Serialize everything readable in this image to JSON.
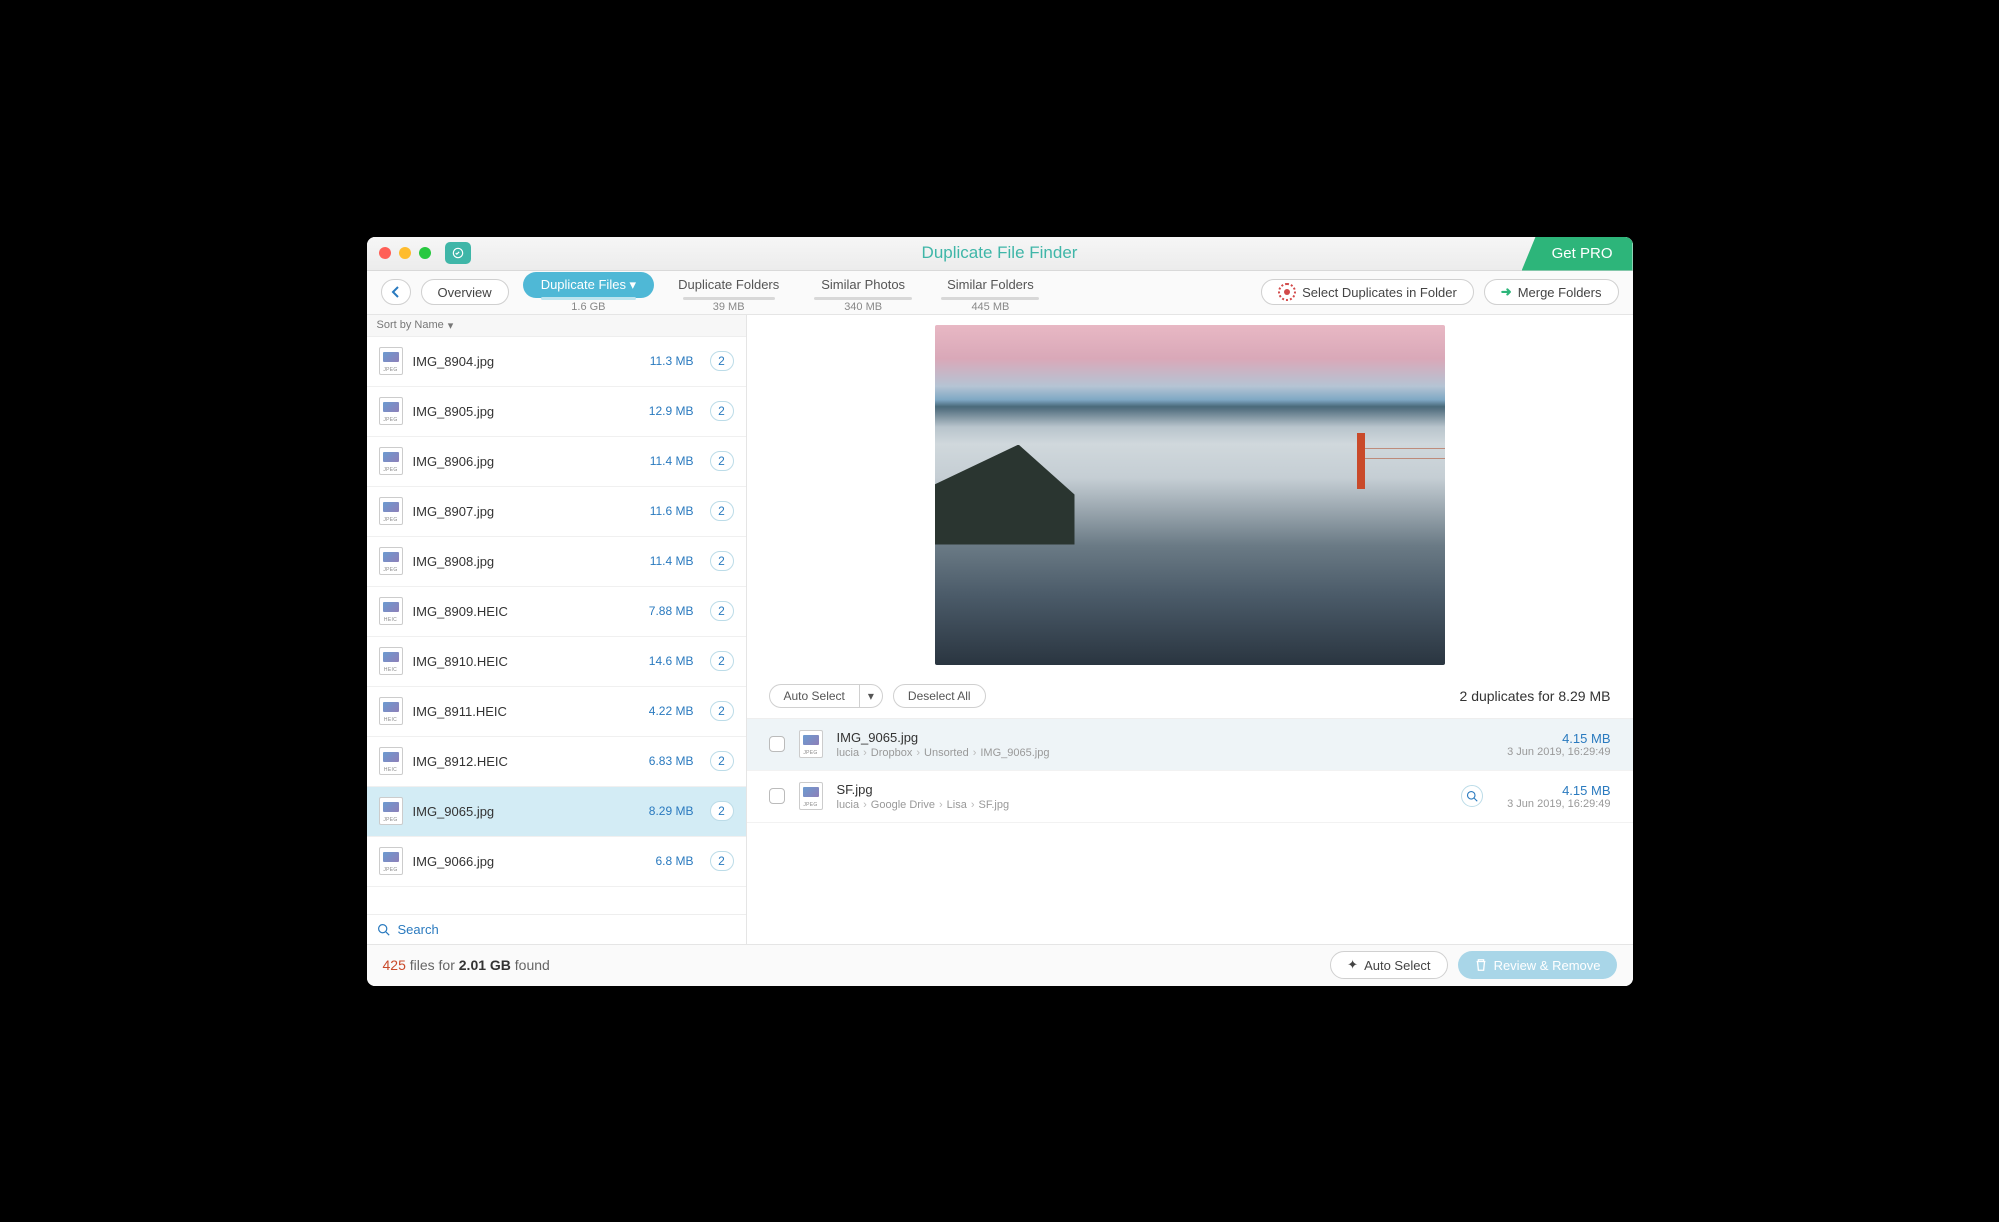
{
  "title": "Duplicate File Finder",
  "get_pro": "Get PRO",
  "toolbar": {
    "overview": "Overview",
    "select_in_folder": "Select Duplicates in Folder",
    "merge_folders": "Merge Folders"
  },
  "tabs": [
    {
      "label": "Duplicate Files",
      "size": "1.6 GB",
      "active": true,
      "dropdown": true
    },
    {
      "label": "Duplicate Folders",
      "size": "39 MB",
      "active": false
    },
    {
      "label": "Similar Photos",
      "size": "340 MB",
      "active": false
    },
    {
      "label": "Similar Folders",
      "size": "445 MB",
      "active": false
    }
  ],
  "sort_label": "Sort by Name",
  "files": [
    {
      "name": "IMG_8904.jpg",
      "size": "11.3 MB",
      "count": "2",
      "ext": "JPEG"
    },
    {
      "name": "IMG_8905.jpg",
      "size": "12.9 MB",
      "count": "2",
      "ext": "JPEG"
    },
    {
      "name": "IMG_8906.jpg",
      "size": "11.4 MB",
      "count": "2",
      "ext": "JPEG"
    },
    {
      "name": "IMG_8907.jpg",
      "size": "11.6 MB",
      "count": "2",
      "ext": "JPEG"
    },
    {
      "name": "IMG_8908.jpg",
      "size": "11.4 MB",
      "count": "2",
      "ext": "JPEG"
    },
    {
      "name": "IMG_8909.HEIC",
      "size": "7.88 MB",
      "count": "2",
      "ext": "HEIC"
    },
    {
      "name": "IMG_8910.HEIC",
      "size": "14.6 MB",
      "count": "2",
      "ext": "HEIC"
    },
    {
      "name": "IMG_8911.HEIC",
      "size": "4.22 MB",
      "count": "2",
      "ext": "HEIC"
    },
    {
      "name": "IMG_8912.HEIC",
      "size": "6.83 MB",
      "count": "2",
      "ext": "HEIC"
    },
    {
      "name": "IMG_9065.jpg",
      "size": "8.29 MB",
      "count": "2",
      "ext": "JPEG",
      "selected": true
    },
    {
      "name": "IMG_9066.jpg",
      "size": "6.8 MB",
      "count": "2",
      "ext": "JPEG"
    }
  ],
  "search_placeholder": "Search",
  "detail": {
    "auto_select": "Auto Select",
    "deselect_all": "Deselect All",
    "summary": "2 duplicates for 8.29 MB"
  },
  "dupes": [
    {
      "name": "IMG_9065.jpg",
      "path": [
        "lucia",
        "Dropbox",
        "Unsorted",
        "IMG_9065.jpg"
      ],
      "size": "4.15 MB",
      "date": "3 Jun 2019, 16:29:49",
      "selected": true
    },
    {
      "name": "SF.jpg",
      "path": [
        "lucia",
        "Google Drive",
        "Lisa",
        "SF.jpg"
      ],
      "size": "4.15 MB",
      "date": "3 Jun 2019, 16:29:49",
      "selected": false,
      "zoom": true
    }
  ],
  "footer": {
    "count": "425",
    "mid": " files for ",
    "total": "2.01 GB",
    "suffix": " found",
    "auto_select": "Auto Select",
    "review": "Review & Remove"
  }
}
